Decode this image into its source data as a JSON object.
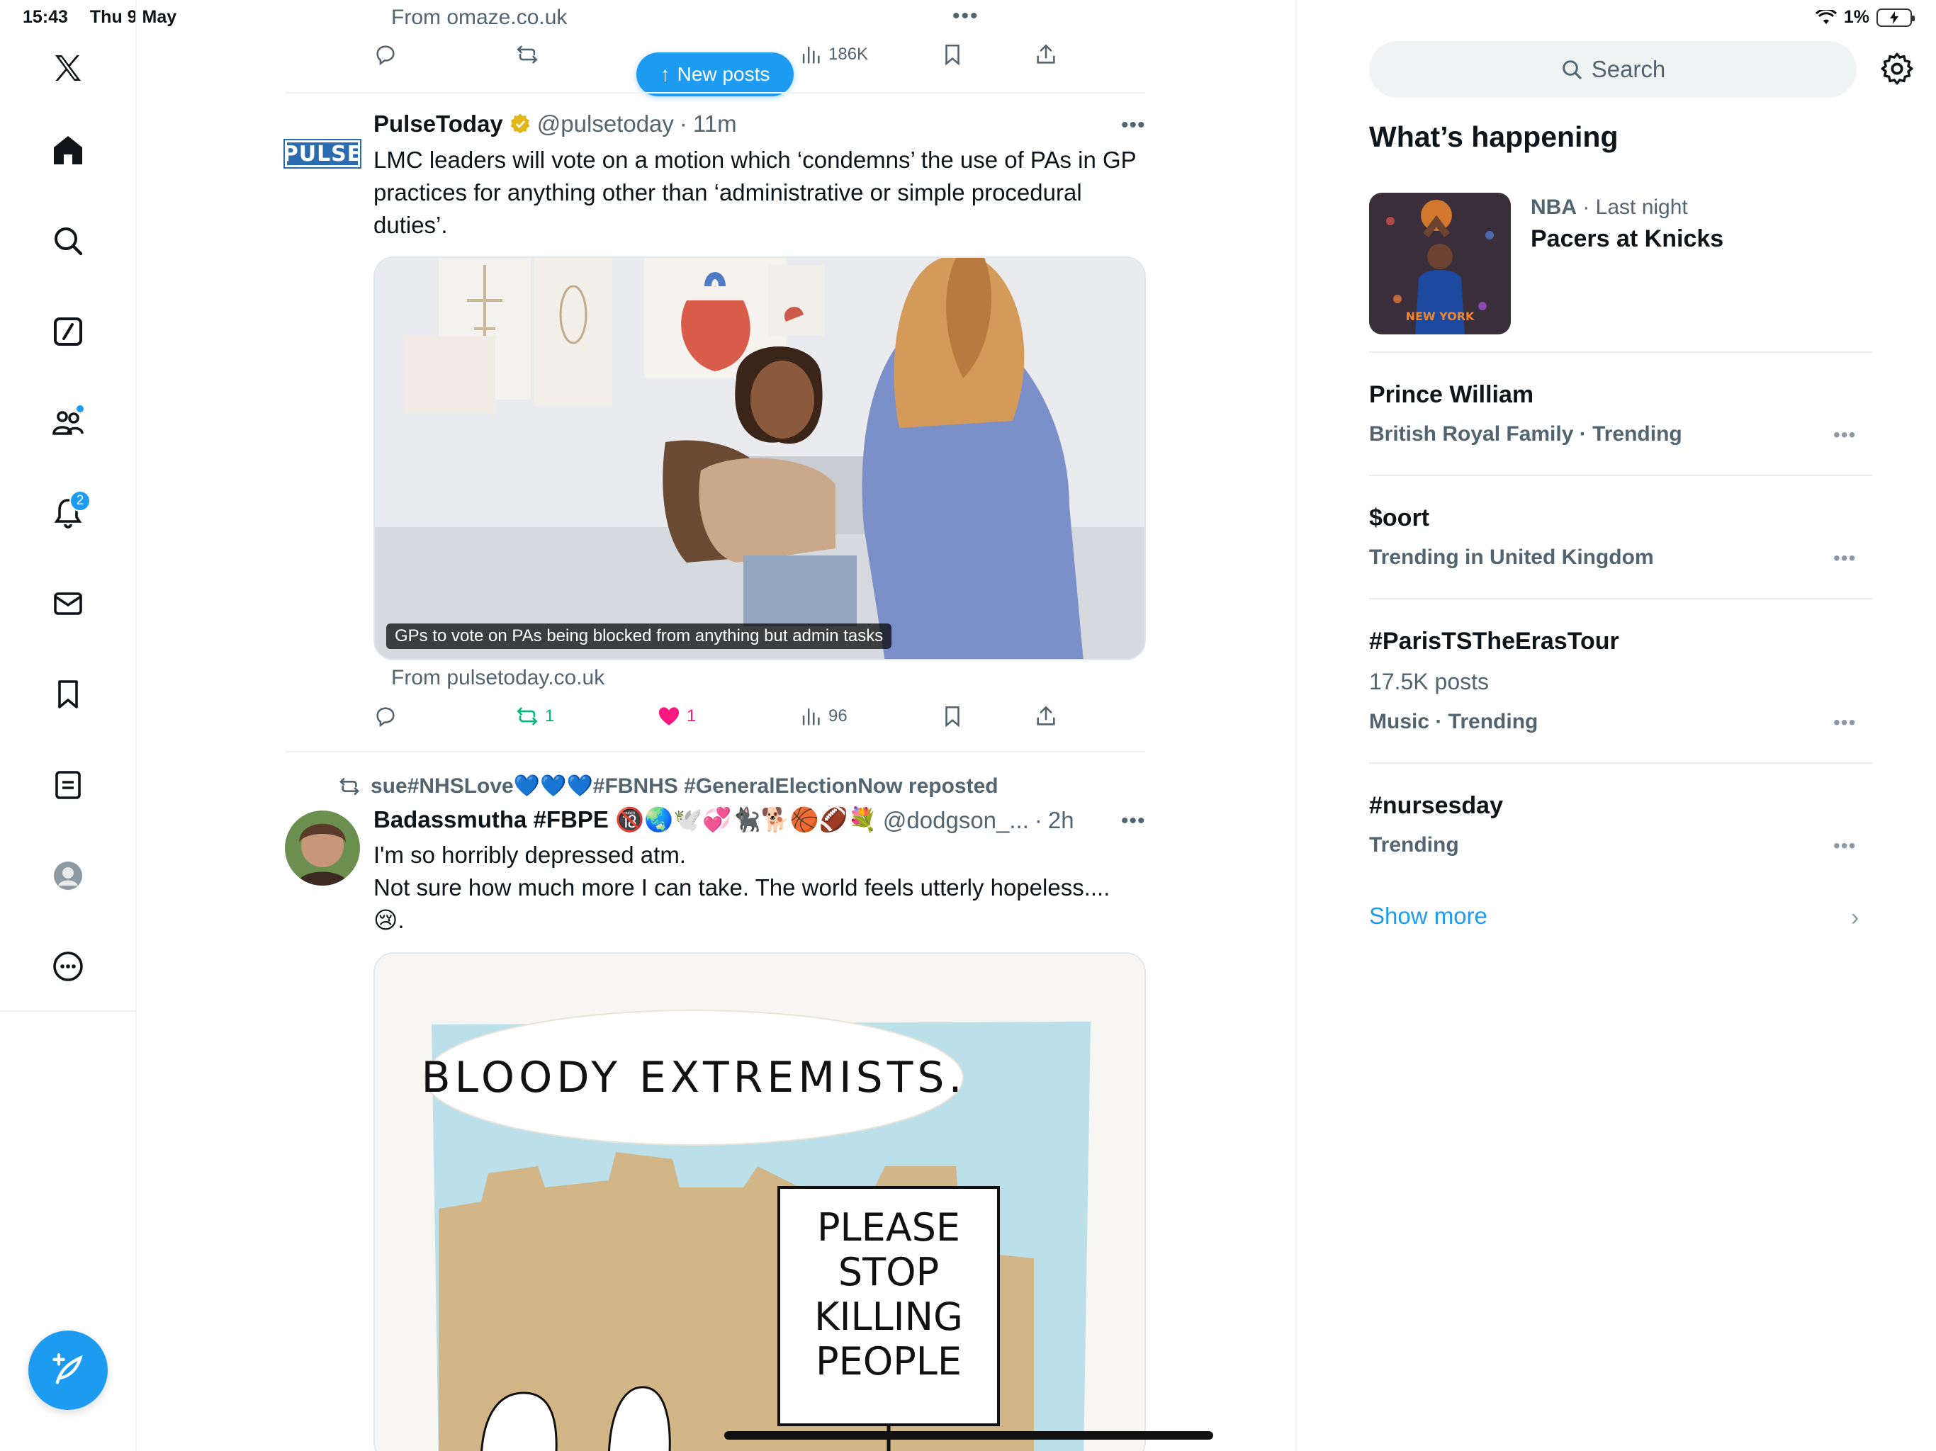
{
  "status_bar": {
    "time": "15:43",
    "date": "Thu 9 May",
    "battery": "1%"
  },
  "nav": {
    "notifications_badge": "2"
  },
  "feed": {
    "prev_tweet": {
      "from": "From omaze.co.uk",
      "views": "186K"
    },
    "new_posts_label": "New posts",
    "tweet1": {
      "name": "PulseToday",
      "handle": "@pulsetoday",
      "time": "11m",
      "avatar_text": "PULSE",
      "text": "LMC leaders will vote on a motion which ‘condemns’ the use of PAs in GP practices for anything other than ‘administrative or simple procedural duties’.",
      "media_caption": "GPs to vote on PAs being blocked from anything but admin tasks",
      "from": "From pulsetoday.co.uk",
      "reposts": "1",
      "likes": "1",
      "views": "96"
    },
    "tweet2": {
      "reposted_by": "sue#NHSLove💙💙💙#FBNHS #GeneralElectionNow reposted",
      "name": "Badassmutha #FBPE 🔞🌏🕊️💞🐈‍⬛🐕🏀🏈💐",
      "handle": "@dodgson_...",
      "time": "2h",
      "text_line1": "I'm so horribly depressed atm.",
      "text_line2": "Not sure how much more I can take. The world feels utterly hopeless....",
      "text_line3": "😢.",
      "cartoon_speech": "BLOODY EXTREMISTS.",
      "cartoon_sign": [
        "PLEASE",
        "STOP",
        "KILLING",
        "PEOPLE"
      ]
    }
  },
  "sidebar": {
    "search_placeholder": "Search",
    "whats_happening_title": "What’s happening",
    "trends": [
      {
        "meta_category": "NBA",
        "meta_time": "· Last night",
        "title": "Pacers at Knicks"
      },
      {
        "title": "Prince William",
        "sub": "British Royal Family · Trending"
      },
      {
        "title": "$oort",
        "sub": "Trending in United Kingdom"
      },
      {
        "title": "#ParisTSTheErasTour",
        "count": "17.5K posts",
        "sub": "Music · Trending"
      },
      {
        "title": "#nursesday",
        "sub": "Trending"
      }
    ],
    "show_more": "Show more"
  },
  "colors": {
    "accent": "#1d9bf0",
    "like": "#f91880",
    "repost": "#00ba7c",
    "secondary_text": "#536471"
  }
}
